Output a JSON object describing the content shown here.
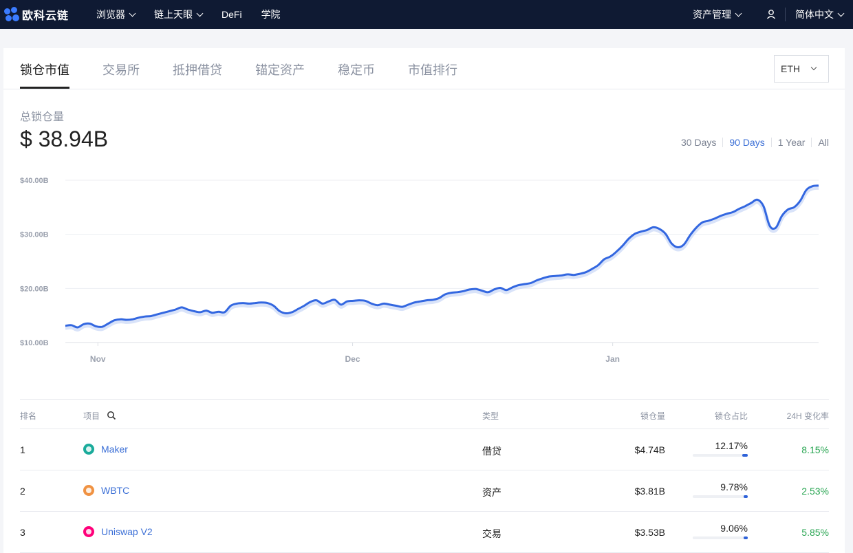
{
  "header": {
    "logo_text": "欧科云链",
    "nav": [
      "浏览器",
      "链上天眼",
      "DeFi",
      "学院"
    ],
    "right": {
      "assets": "资产管理",
      "language": "简体中文"
    }
  },
  "tabs": [
    "锁仓市值",
    "交易所",
    "抵押借贷",
    "锚定资产",
    "稳定币",
    "市值排行"
  ],
  "active_tab": "锁仓市值",
  "select": {
    "value": "ETH"
  },
  "summary": {
    "label": "总锁仓量",
    "value": "$ 38.94B"
  },
  "ranges": [
    "30 Days",
    "90 Days",
    "1 Year",
    "All"
  ],
  "active_range": "90 Days",
  "chart_data": {
    "type": "line",
    "title": "",
    "x_labels": [
      "Nov",
      "Dec",
      "Jan"
    ],
    "y_ticks": [
      "$10.00B",
      "$20.00B",
      "$30.00B",
      "$40.00B"
    ],
    "ylim": [
      10,
      40
    ],
    "x_range": [
      0,
      139
    ],
    "x_label_positions": [
      6,
      53,
      101
    ],
    "grid": true,
    "color": "#3367e0",
    "series": [
      {
        "values": [
          13.1,
          13.2,
          12.8,
          13.4,
          13.5,
          13.0,
          12.9,
          13.5,
          14.1,
          14.3,
          14.2,
          14.3,
          14.6,
          14.8,
          14.9,
          15.2,
          15.5,
          15.8,
          16.1,
          16.5,
          16.1,
          15.8,
          15.6,
          15.9,
          15.5,
          15.7,
          15.6,
          16.8,
          17.2,
          17.3,
          17.2,
          17.3,
          17.4,
          17.3,
          16.8,
          15.8,
          15.4,
          15.6,
          16.2,
          16.8,
          17.5,
          17.8,
          17.2,
          17.6,
          17.9,
          17.0,
          17.6,
          17.7,
          17.8,
          17.7,
          17.2,
          16.9,
          17.2,
          17.0,
          16.8,
          16.6,
          17.0,
          17.4,
          17.6,
          17.8,
          17.9,
          18.2,
          18.9,
          19.2,
          19.3,
          19.5,
          19.8,
          19.9,
          19.6,
          19.3,
          19.8,
          20.1,
          19.7,
          20.2,
          20.6,
          20.8,
          21.0,
          21.5,
          21.9,
          22.2,
          22.3,
          22.4,
          22.6,
          22.5,
          22.7,
          23.0,
          23.6,
          24.3,
          25.4,
          25.9,
          26.8,
          27.9,
          29.2,
          30.1,
          30.5,
          30.8,
          31.3,
          31.0,
          30.1,
          28.3,
          27.6,
          28.1,
          29.8,
          31.2,
          32.2,
          32.5,
          32.9,
          33.4,
          33.8,
          34.1,
          34.7,
          35.2,
          35.8,
          36.4,
          35.2,
          31.6,
          31.2,
          33.4,
          34.6,
          35.0,
          36.2,
          38.2,
          38.9,
          39.0
        ]
      }
    ]
  },
  "table": {
    "headers": {
      "rank": "排名",
      "project": "项目",
      "type": "类型",
      "locked": "锁仓量",
      "share": "锁仓占比",
      "change": "24H 变化率"
    },
    "rows": [
      {
        "rank": "1",
        "name": "Maker",
        "icon": "maker-icon",
        "icon_color": "#1aab9b",
        "type": "借贷",
        "locked": "$4.74B",
        "share": "12.17%",
        "share_value": 12.17,
        "change": "8.15%"
      },
      {
        "rank": "2",
        "name": "WBTC",
        "icon": "wbtc-icon",
        "icon_color": "#f09242",
        "type": "资产",
        "locked": "$3.81B",
        "share": "9.78%",
        "share_value": 9.78,
        "change": "2.53%"
      },
      {
        "rank": "3",
        "name": "Uniswap V2",
        "icon": "uniswap-icon",
        "icon_color": "#ff007a",
        "type": "交易",
        "locked": "$3.53B",
        "share": "9.06%",
        "share_value": 9.06,
        "change": "5.85%"
      }
    ]
  }
}
